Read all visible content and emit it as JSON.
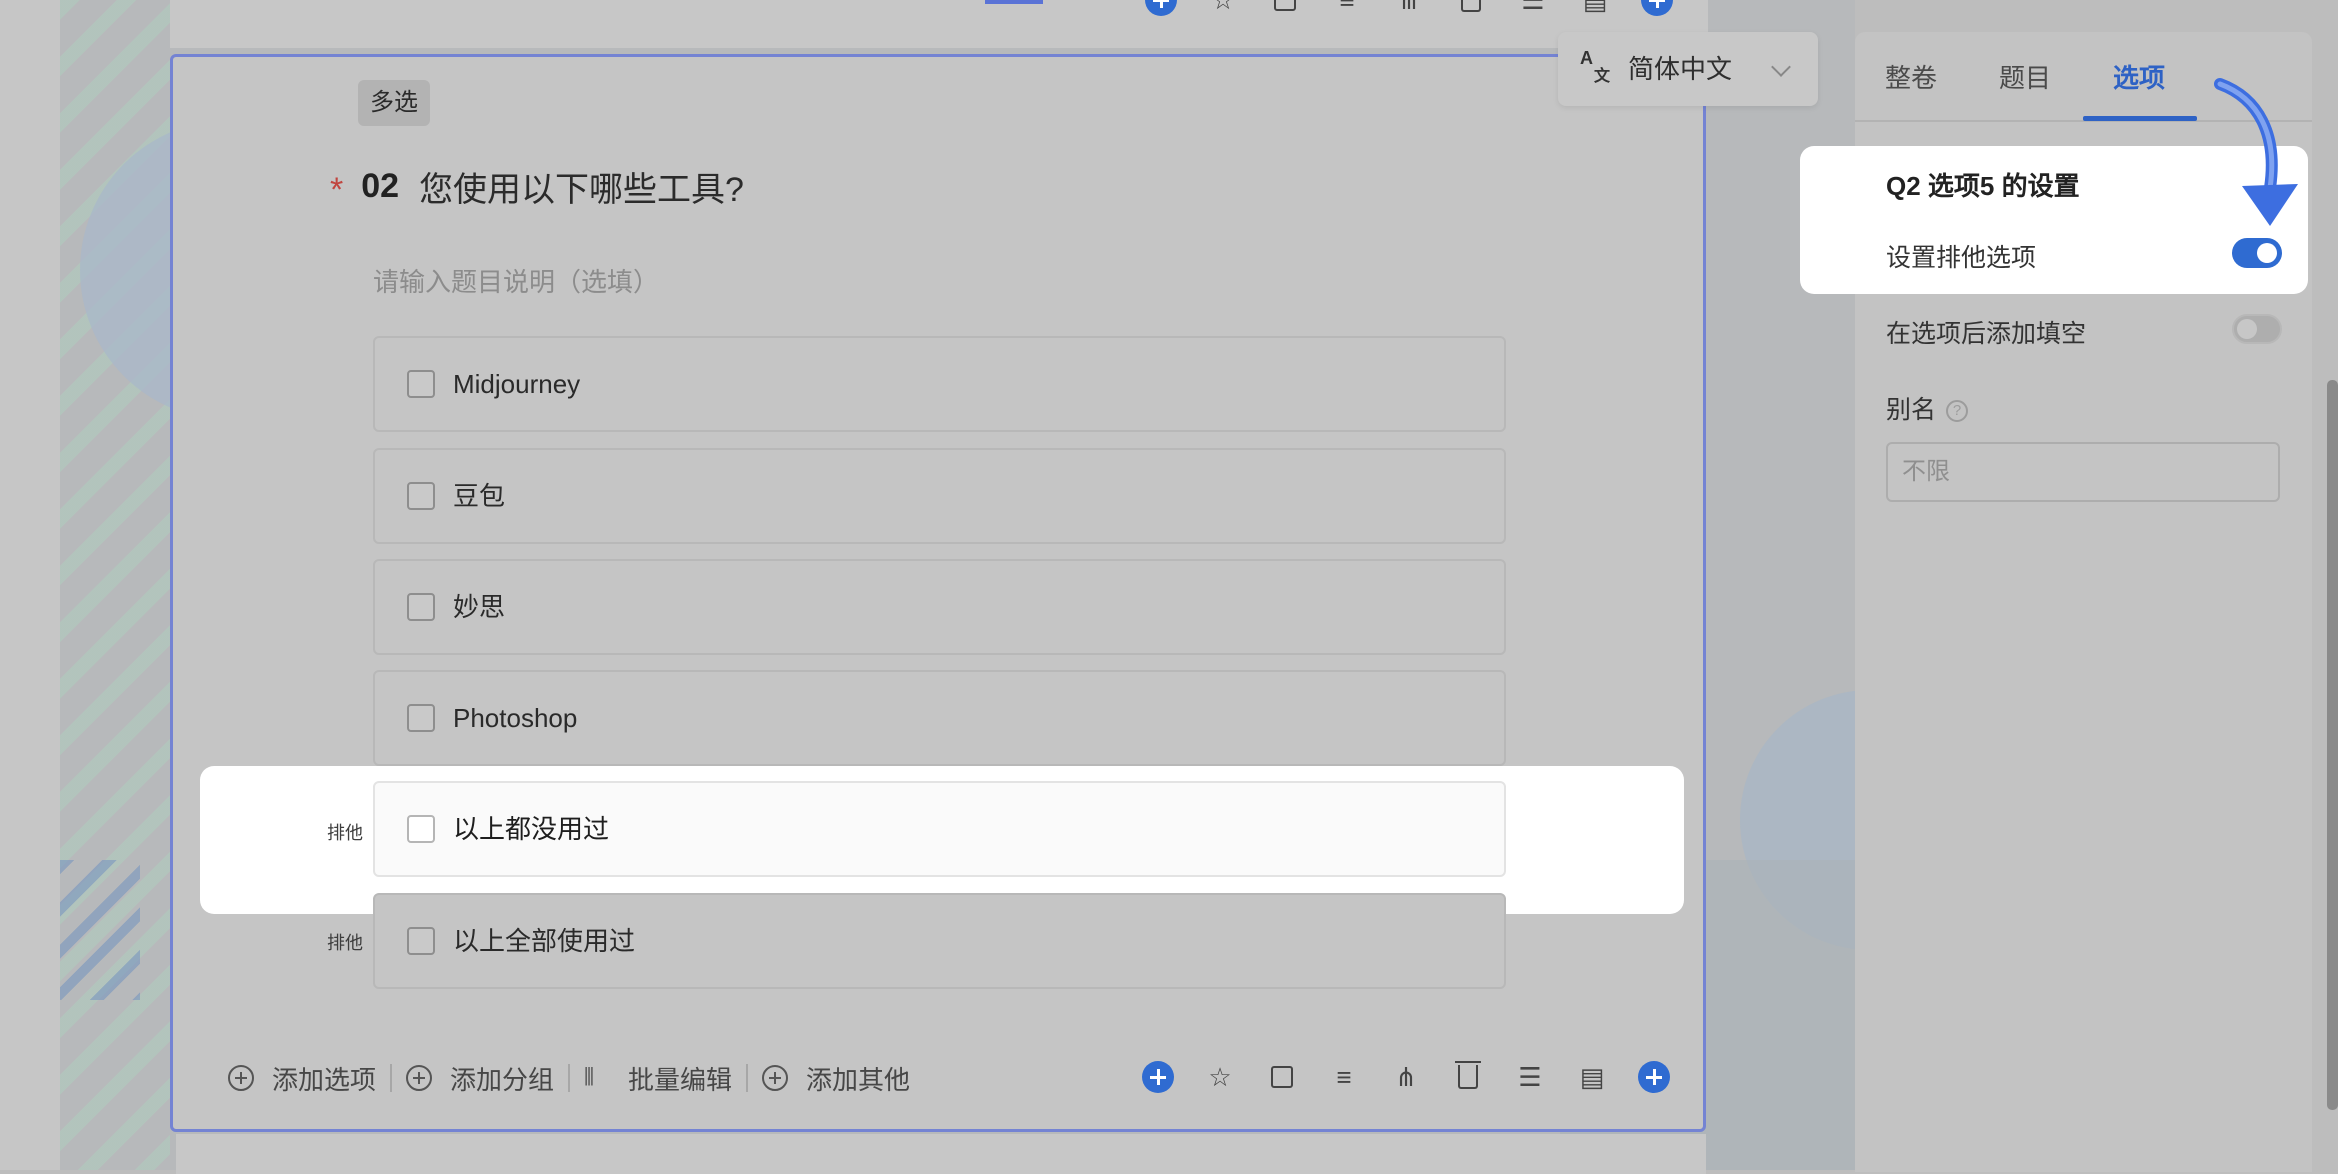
{
  "question": {
    "type_tag": "多选",
    "required_mark": "*",
    "number": "02",
    "title": "您使用以下哪些工具?",
    "description_placeholder": "请输入题目说明（选填）",
    "options": [
      {
        "label": "Midjourney"
      },
      {
        "label": "豆包"
      },
      {
        "label": "妙思"
      },
      {
        "label": "Photoshop"
      },
      {
        "label": "以上都没用过",
        "badge": "排他",
        "highlighted": true
      },
      {
        "label": "以上全部使用过",
        "badge": "排他"
      }
    ],
    "bottom_tools": {
      "add_option": "添加选项",
      "add_group": "添加分组",
      "batch_edit": "批量编辑",
      "add_other": "添加其他"
    }
  },
  "language": {
    "value": "简体中文"
  },
  "panel": {
    "tabs": [
      {
        "label": "整卷"
      },
      {
        "label": "题目"
      },
      {
        "label": "选项",
        "active": true
      }
    ],
    "settings_title": "Q2 选项5 的设置",
    "exclusive_option": {
      "label": "设置排他选项",
      "on": true
    },
    "add_blank": {
      "label": "在选项后添加填空",
      "on": false
    },
    "alias": {
      "label": "别名",
      "help": "?",
      "placeholder": "不限"
    }
  },
  "colors": {
    "accent": "#2f6bd1",
    "card_border": "#7483d3",
    "required": "#c1453f"
  }
}
